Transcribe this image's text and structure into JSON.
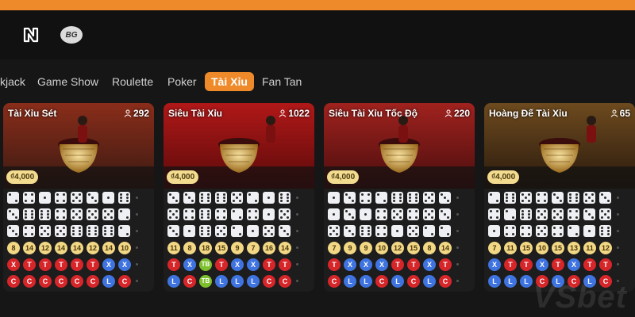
{
  "brand": {
    "bg_logo": "BG",
    "watermark": "VSbet",
    "accent": "#ef8a2a"
  },
  "nav": {
    "tabs": [
      {
        "label": "kjack"
      },
      {
        "label": "Game Show"
      },
      {
        "label": "Roulette"
      },
      {
        "label": "Poker"
      },
      {
        "label": "Tài Xỉu",
        "active": true
      },
      {
        "label": "Fan Tan"
      }
    ]
  },
  "tables": [
    {
      "title": "Tài Xỉu Sét",
      "players": "292",
      "min_bet": "₫4,000",
      "dice": [
        [
          2,
          4,
          1,
          4,
          5,
          3,
          1,
          6
        ],
        [
          3,
          6,
          6,
          4,
          5,
          5,
          5,
          2
        ],
        [
          3,
          4,
          5,
          5,
          6,
          6,
          6,
          2
        ]
      ],
      "totals": [
        "8",
        "14",
        "12",
        "14",
        "14",
        "12",
        "14",
        "10"
      ],
      "outcome": [
        [
          "X",
          "red"
        ],
        [
          "T",
          "red"
        ],
        [
          "T",
          "red"
        ],
        [
          "T",
          "red"
        ],
        [
          "T",
          "red"
        ],
        [
          "T",
          "red"
        ],
        [
          "X",
          "blue"
        ],
        [
          "X",
          "blue"
        ]
      ],
      "parity": [
        [
          "C",
          "red"
        ],
        [
          "C",
          "red"
        ],
        [
          "C",
          "red"
        ],
        [
          "C",
          "red"
        ],
        [
          "C",
          "red"
        ],
        [
          "C",
          "red"
        ],
        [
          "L",
          "blue"
        ],
        [
          "C",
          "red"
        ]
      ]
    },
    {
      "title": "Siêu Tài Xỉu",
      "players": "1022",
      "min_bet": "₫4,000",
      "dice": [
        [
          3,
          3,
          6,
          6,
          5,
          2,
          1,
          6
        ],
        [
          5,
          4,
          6,
          4,
          2,
          4,
          1,
          5
        ],
        [
          3,
          1,
          6,
          5,
          2,
          1,
          5,
          3
        ]
      ],
      "totals": [
        "11",
        "8",
        "18",
        "15",
        "9",
        "7",
        "16",
        "14"
      ],
      "outcome": [
        [
          "T",
          "red"
        ],
        [
          "X",
          "blue"
        ],
        [
          "TB",
          "green"
        ],
        [
          "T",
          "red"
        ],
        [
          "X",
          "blue"
        ],
        [
          "X",
          "blue"
        ],
        [
          "T",
          "red"
        ],
        [
          "T",
          "red"
        ]
      ],
      "parity": [
        [
          "L",
          "blue"
        ],
        [
          "C",
          "red"
        ],
        [
          "TB",
          "green"
        ],
        [
          "L",
          "blue"
        ],
        [
          "L",
          "blue"
        ],
        [
          "L",
          "blue"
        ],
        [
          "C",
          "red"
        ],
        [
          "C",
          "red"
        ]
      ]
    },
    {
      "title": "Siêu Tài Xỉu Tốc Độ",
      "players": "220",
      "min_bet": "₫4,000",
      "dice": [
        [
          1,
          3,
          4,
          2,
          6,
          6,
          5,
          3
        ],
        [
          1,
          3,
          1,
          4,
          5,
          4,
          5,
          3
        ],
        [
          5,
          3,
          6,
          4,
          1,
          5,
          2,
          2
        ]
      ],
      "totals": [
        "7",
        "9",
        "9",
        "10",
        "12",
        "15",
        "8",
        "14"
      ],
      "outcome": [
        [
          "T",
          "red"
        ],
        [
          "X",
          "blue"
        ],
        [
          "X",
          "blue"
        ],
        [
          "X",
          "blue"
        ],
        [
          "T",
          "red"
        ],
        [
          "T",
          "red"
        ],
        [
          "X",
          "blue"
        ],
        [
          "T",
          "red"
        ]
      ],
      "parity": [
        [
          "C",
          "red"
        ],
        [
          "L",
          "blue"
        ],
        [
          "L",
          "blue"
        ],
        [
          "C",
          "red"
        ],
        [
          "L",
          "blue"
        ],
        [
          "C",
          "red"
        ],
        [
          "L",
          "blue"
        ],
        [
          "C",
          "red"
        ]
      ]
    },
    {
      "title": "Hoàng Đế Tài Xỉu",
      "players": "65",
      "min_bet": "₫4,000",
      "dice": [
        [
          2,
          6,
          5,
          4,
          3,
          6,
          5,
          3
        ],
        [
          4,
          2,
          6,
          5,
          5,
          4,
          3,
          5
        ],
        [
          1,
          4,
          4,
          5,
          4,
          2,
          1,
          6
        ]
      ],
      "totals": [
        "7",
        "11",
        "15",
        "10",
        "15",
        "13",
        "11",
        "12"
      ],
      "outcome": [
        [
          "X",
          "blue"
        ],
        [
          "T",
          "red"
        ],
        [
          "T",
          "red"
        ],
        [
          "X",
          "blue"
        ],
        [
          "T",
          "red"
        ],
        [
          "X",
          "blue"
        ],
        [
          "T",
          "red"
        ],
        [
          "T",
          "red"
        ]
      ],
      "parity": [
        [
          "L",
          "blue"
        ],
        [
          "L",
          "blue"
        ],
        [
          "L",
          "blue"
        ],
        [
          "C",
          "red"
        ],
        [
          "L",
          "blue"
        ],
        [
          "C",
          "red"
        ],
        [
          "L",
          "blue"
        ],
        [
          "C",
          "red"
        ]
      ]
    }
  ]
}
